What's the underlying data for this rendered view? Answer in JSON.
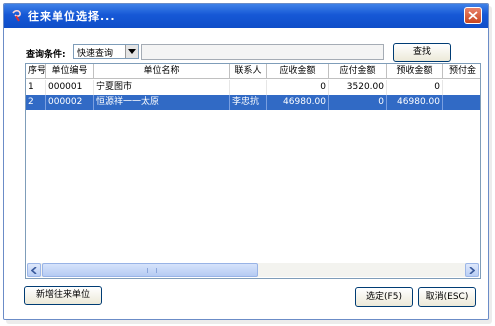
{
  "window": {
    "title": "往来单位选择..."
  },
  "filter": {
    "label": "查询条件:",
    "mode": "快速查询",
    "query": "",
    "search_label": "查找"
  },
  "grid": {
    "columns": [
      "序号",
      "单位编号",
      "单位名称",
      "联系人",
      "应收金额",
      "应付金额",
      "预收金额",
      "预付金"
    ],
    "rows": [
      {
        "cells": [
          "1",
          "000001",
          "宁夏图市",
          "",
          "0",
          "3520.00",
          "0",
          ""
        ],
        "selected": false
      },
      {
        "cells": [
          "2",
          "000002",
          "恒源祥一一太原",
          "李忠抗",
          "46980.00",
          "0",
          "46980.00",
          ""
        ],
        "selected": true
      }
    ]
  },
  "footer": {
    "add_label": "新增往来单位",
    "ok_label": "选定(F5)",
    "cancel_label": "取消(ESC)"
  },
  "colors": {
    "titlebar": "#0f4ec8",
    "selection": "#316ac5",
    "close": "#c9461f"
  },
  "icons": [
    "app-icon",
    "close-icon",
    "dropdown-arrow-icon",
    "scroll-left-icon",
    "scroll-right-icon"
  ]
}
